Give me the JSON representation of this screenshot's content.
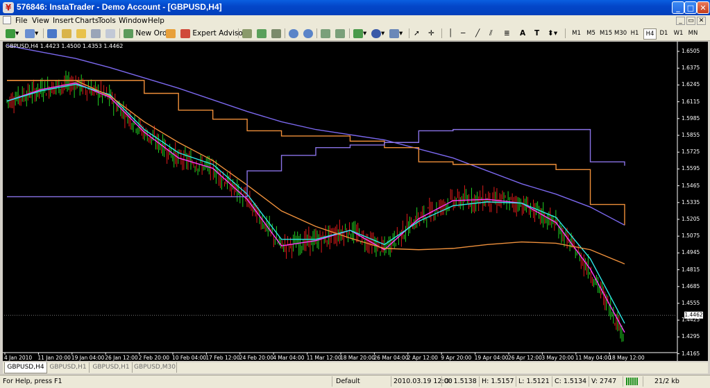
{
  "window": {
    "title": "576846: InstaTrader - Demo Account - [GBPUSD,H4]",
    "controls": {
      "minimize": "_",
      "maximize": "□",
      "close": "✕"
    }
  },
  "menu": {
    "items": [
      "File",
      "View",
      "Insert",
      "Charts",
      "Tools",
      "Window",
      "Help"
    ],
    "mdi_controls": {
      "minimize": "_",
      "restore": "▭",
      "close": "✕"
    }
  },
  "toolbar": {
    "new_order": "New Order",
    "expert_advisors": "Expert Advisors",
    "text_tool": "A",
    "text_label_tool": "T",
    "timeframes": [
      "M1",
      "M5",
      "M15",
      "M30",
      "H1",
      "H4",
      "D1",
      "W1",
      "MN"
    ],
    "active_timeframe": "H4"
  },
  "chart": {
    "header": "GBPUSD,H4  1.4423 1.4500 1.4353 1.4462",
    "current_price": "1.4462",
    "hidden_price_label": "1.4425",
    "price_ticks": [
      "1.6505",
      "1.6375",
      "1.6245",
      "1.6115",
      "1.5985",
      "1.5855",
      "1.5725",
      "1.5595",
      "1.5465",
      "1.5335",
      "1.5205",
      "1.5075",
      "1.4945",
      "1.4815",
      "1.4685",
      "1.4555",
      "1.4425",
      "1.4295",
      "1.4165"
    ],
    "time_ticks": [
      "4 Jan 2010",
      "11 Jan 20:00",
      "19 Jan 04:00",
      "26 Jan 12:00",
      "2 Feb 20:00",
      "10 Feb 04:00",
      "17 Feb 12:00",
      "24 Feb 20:00",
      "4 Mar 04:00",
      "11 Mar 12:00",
      "18 Mar 20:00",
      "26 Mar 04:00",
      "2 Apr 12:00",
      "9 Apr 20:00",
      "19 Apr 04:00",
      "26 Apr 12:00",
      "3 May 20:00",
      "11 May 04:00",
      "18 May 12:00"
    ],
    "colors": {
      "background": "#000000",
      "candles_up": "#22d122",
      "candles_down": "#e11b1b",
      "ma_fast": "#ff3cff",
      "ma_mid": "#2ee8e8",
      "ma_slow": "#f0913c",
      "ma_long": "#7b68ee",
      "channel_upper": "#ef8f3a",
      "channel_lower": "#8a73e8",
      "channel_mid": "#1fd9d9"
    }
  },
  "chart_data": {
    "type": "line",
    "title": "GBPUSD,H4",
    "ohlc_header": {
      "open": 1.4423,
      "high": 1.45,
      "low": 1.4353,
      "close": 1.4462
    },
    "x": [
      "4 Jan 2010",
      "11 Jan 20:00",
      "19 Jan 04:00",
      "26 Jan 12:00",
      "2 Feb 20:00",
      "10 Feb 04:00",
      "17 Feb 12:00",
      "24 Feb 20:00",
      "4 Mar 04:00",
      "11 Mar 12:00",
      "18 Mar 20:00",
      "26 Mar 04:00",
      "2 Apr 12:00",
      "9 Apr 20:00",
      "19 Apr 04:00",
      "26 Apr 12:00",
      "3 May 20:00",
      "11 May 04:00",
      "18 May 12:00"
    ],
    "ylim": [
      1.4165,
      1.6505
    ],
    "series": [
      {
        "values": [
          1.612,
          1.621,
          1.626,
          1.615,
          1.588,
          1.568,
          1.56,
          1.536,
          1.5,
          1.504,
          1.512,
          1.497,
          1.521,
          1.535,
          1.536,
          1.533,
          1.518,
          1.482,
          1.433
        ]
      },
      {
        "values": [
          1.612,
          1.62,
          1.625,
          1.617,
          1.59,
          1.572,
          1.563,
          1.54,
          1.505,
          1.505,
          1.512,
          1.501,
          1.519,
          1.531,
          1.534,
          1.533,
          1.522,
          1.49,
          1.44
        ]
      },
      {
        "values": [
          1.628,
          1.628,
          1.628,
          1.616,
          1.596,
          1.58,
          1.566,
          1.547,
          1.527,
          1.515,
          1.506,
          1.498,
          1.497,
          1.498,
          1.501,
          1.503,
          1.502,
          1.497,
          1.486
        ]
      },
      {
        "values": [
          1.655,
          1.65,
          1.645,
          1.638,
          1.63,
          1.622,
          1.613,
          1.604,
          1.596,
          1.59,
          1.586,
          1.582,
          1.575,
          1.568,
          1.558,
          1.548,
          1.54,
          1.53,
          1.516
        ]
      },
      {
        "values": [
          1.628,
          1.628,
          1.628,
          1.628,
          1.618,
          1.605,
          1.598,
          1.589,
          1.585,
          1.585,
          1.581,
          1.576,
          1.565,
          1.563,
          1.563,
          1.563,
          1.559,
          1.532,
          1.516
        ]
      },
      {
        "values": [
          1.538,
          1.538,
          1.538,
          1.538,
          1.538,
          1.538,
          1.538,
          1.558,
          1.57,
          1.576,
          1.578,
          1.58,
          1.589,
          1.59,
          1.59,
          1.59,
          1.59,
          1.565,
          1.562
        ]
      }
    ]
  },
  "tabs": [
    "GBPUSD,H4",
    "GBPUSD,H1",
    "GBPUSD,H1",
    "GBPUSD,M30"
  ],
  "status": {
    "help": "For Help, press F1",
    "profile": "Default",
    "datetime": "2010.03.19 12:00",
    "open": "O: 1.5138",
    "high": "H: 1.5157",
    "low": "L: 1.5121",
    "close": "C: 1.5134",
    "volume": "V: 2747",
    "traffic": "21/2 kb"
  }
}
